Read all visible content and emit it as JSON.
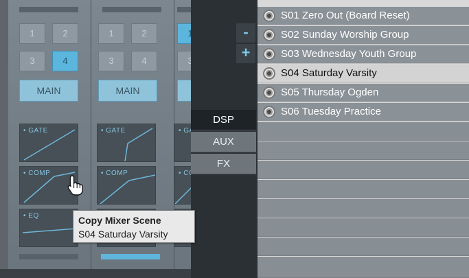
{
  "mixer": {
    "channels": [
      {
        "bus_chips": [
          "1",
          "2",
          "3",
          "4"
        ],
        "active_chip": "4",
        "main_label": "MAIN",
        "dsp": {
          "gate": "GATE",
          "comp": "COMP",
          "eq": "EQ"
        }
      },
      {
        "bus_chips": [
          "1",
          "2",
          "3",
          "4"
        ],
        "active_chip": "",
        "main_label": "MAIN",
        "dsp": {
          "gate": "GATE",
          "comp": "COMP"
        }
      },
      {
        "bus_chips": [
          "1",
          "3"
        ],
        "main_label": "",
        "dsp": {
          "gate": "GA",
          "comp": "CO"
        }
      }
    ]
  },
  "panel": {
    "minus_label": "-",
    "plus_label": "+",
    "tabs": [
      "DSP",
      "AUX",
      "FX"
    ],
    "active_tab": "DSP"
  },
  "scenes": {
    "items": [
      "S01 Zero Out (Board Reset)",
      "S02 Sunday Worship Group",
      "S03 Wednesday Youth Group",
      "S04 Saturday Varsity",
      "S05 Thursday Ogden",
      "S06 Tuesday Practice"
    ],
    "selected_index": 3
  },
  "tooltip": {
    "title": "Copy Mixer Scene",
    "subtitle": "S04 Saturday Varsity"
  },
  "colors": {
    "accent_blue": "#5cb5dc",
    "panel_dark": "#2b3034",
    "selected_row": "#d3d3d3"
  },
  "icons": {
    "scene_row_icon": "disk-icon",
    "cursor": "hand-pointer-icon"
  }
}
